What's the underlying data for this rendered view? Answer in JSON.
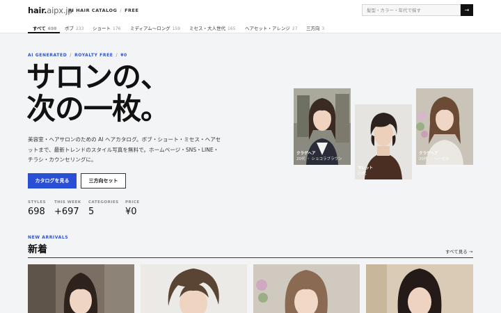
{
  "header": {
    "logo_main": "hair.",
    "logo_sub": "aipx.jp",
    "crumb_1": "AI HAIR CATALOG",
    "crumb_sep": "/",
    "crumb_2": "FREE",
    "search_placeholder": "髪型・カラー・年代で探す",
    "search_button": "→"
  },
  "tabs": [
    {
      "label": "すべて",
      "count": "698"
    },
    {
      "label": "ボブ",
      "count": "233"
    },
    {
      "label": "ショート",
      "count": "176"
    },
    {
      "label": "ミディアム〜ロング",
      "count": "159"
    },
    {
      "label": "ミセス・大人世代",
      "count": "165"
    },
    {
      "label": "ヘアセット・アレンジ",
      "count": "27"
    },
    {
      "label": "三方向",
      "count": "3"
    }
  ],
  "hero": {
    "eyebrow_1": "AI GENERATED",
    "eyebrow_2": "ROYALTY FREE",
    "eyebrow_3": "¥0",
    "eyebrow_sep": "/",
    "title_line1": "サロンの、",
    "title_line2": "次の一枚。",
    "description": "美容室・ヘアサロンのための AI ヘアカタログ。ボブ・ショート・ミセス・ヘアセットまで、最新トレンドのスタイル写真を無料で。ホームページ・SNS・LINE・チラシ・カウンセリングに。",
    "primary_button": "カタログを見る",
    "secondary_button": "三方向セット"
  },
  "stats": [
    {
      "label": "STYLES",
      "value": "698"
    },
    {
      "label": "THIS WEEK",
      "value": "+697"
    },
    {
      "label": "CATEGORIES",
      "value": "5"
    },
    {
      "label": "PRICE",
      "value": "¥0"
    }
  ],
  "cards": [
    {
      "title": "クラゲヘア",
      "sub": "20代 ・ ショコラブラウン"
    },
    {
      "title": "マレット",
      "sub": "20代"
    },
    {
      "title": "クラゲヘア",
      "sub": "20代 ・ ヘーゼル"
    }
  ],
  "new_arrivals": {
    "eyebrow": "NEW ARRIVALS",
    "title": "新着",
    "see_all": "すべて見る →"
  }
}
